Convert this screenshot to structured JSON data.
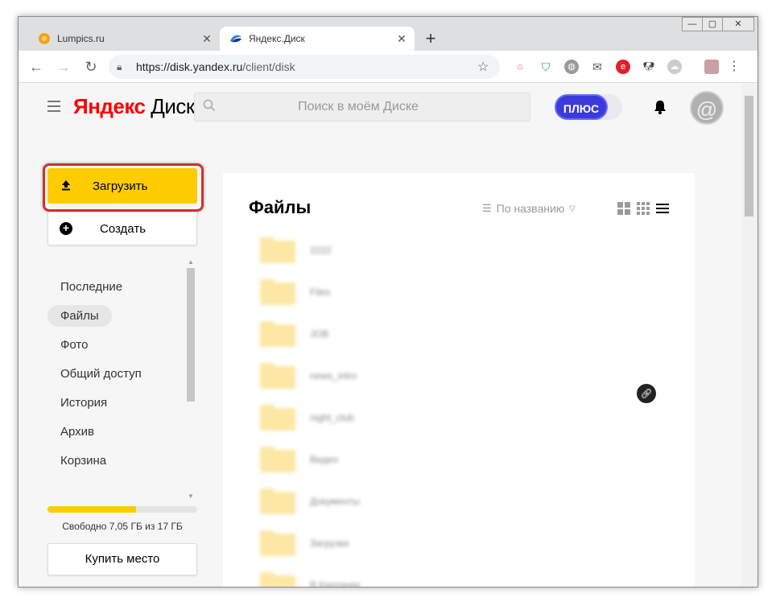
{
  "browser": {
    "tabs": [
      {
        "title": "Lumpics.ru",
        "active": false,
        "favicon": "orange-circle-icon"
      },
      {
        "title": "Яндекс.Диск",
        "active": true,
        "favicon": "yandex-disk-icon"
      }
    ],
    "url_host": "https://disk.yandex.ru",
    "url_path": "/client/disk",
    "window_controls": {
      "minimize": "—",
      "restore": "▢",
      "close": "✕"
    }
  },
  "app": {
    "logo_yandex": "Яндекс",
    "logo_disk": "Диск",
    "search_placeholder": "Поиск в моём Диске",
    "plus_label": "ПЛЮС",
    "accent_color": "#ffcc00",
    "plus_color": "#3b3bdc"
  },
  "sidebar": {
    "upload_label": "Загрузить",
    "create_label": "Создать",
    "items": [
      {
        "label": "Последние",
        "active": false
      },
      {
        "label": "Файлы",
        "active": true
      },
      {
        "label": "Фото",
        "active": false
      },
      {
        "label": "Общий доступ",
        "active": false
      },
      {
        "label": "История",
        "active": false
      },
      {
        "label": "Архив",
        "active": false
      },
      {
        "label": "Корзина",
        "active": false
      }
    ],
    "storage_used_fraction": 0.59,
    "storage_text": "Свободно 7,05 ГБ из 17 ГБ",
    "buy_label": "Купить место"
  },
  "main": {
    "title": "Файлы",
    "sort_label": "По названию",
    "files": [
      {
        "name": "2222"
      },
      {
        "name": "Files"
      },
      {
        "name": "JOB"
      },
      {
        "name": "news_intro"
      },
      {
        "name": "night_club"
      },
      {
        "name": "Видео"
      },
      {
        "name": "Документы"
      },
      {
        "name": "Загрузки"
      },
      {
        "name": "В.Картинки"
      }
    ]
  }
}
